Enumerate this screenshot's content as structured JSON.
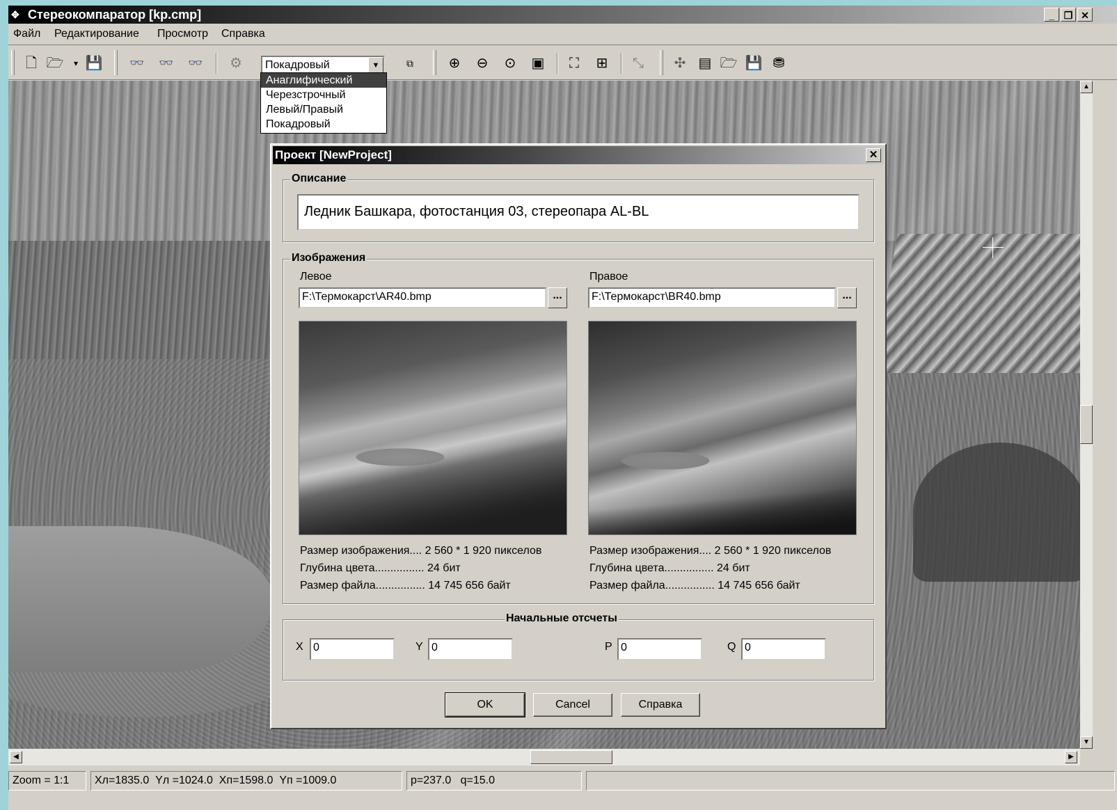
{
  "window": {
    "title": "Стереокомпаратор [kp.cmp]"
  },
  "menu": [
    "Файл",
    "Редактирование",
    "Просмотр",
    "Справка"
  ],
  "toolbar": {
    "mode_combo_value": "Покадровый",
    "mode_options": [
      "Анаглифический",
      "Черезстрочный",
      "Левый/Правый",
      "Покадровый"
    ],
    "selected_option_index": 0
  },
  "dialog": {
    "title": "Проект [NewProject]",
    "description_group": "Описание",
    "description": "Ледник Башкара, фотостанция 03, стереопара AL-BL",
    "images_group": "Изображения",
    "left": {
      "label": "Левое",
      "path": "F:\\Термокарст\\AR40.bmp",
      "info": [
        "Размер изображения.... 2 560 * 1 920 пикселов",
        "Глубина цвета................ 24 бит",
        "Размер файла................ 14 745 656 байт"
      ]
    },
    "right": {
      "label": "Правое",
      "path": "F:\\Термокарст\\BR40.bmp",
      "info": [
        "Размер изображения.... 2 560 * 1 920 пикселов",
        "Глубина цвета................ 24 бит",
        "Размер файла................ 14 745 656 байт"
      ]
    },
    "browse_label": "...",
    "origin_group": "Начальные отсчеты",
    "origin": {
      "x_label": "X",
      "x": "0",
      "y_label": "Y",
      "y": "0",
      "p_label": "P",
      "p": "0",
      "q_label": "Q",
      "q": "0"
    },
    "buttons": {
      "ok": "OK",
      "cancel": "Cancel",
      "help": "Справка"
    }
  },
  "status": {
    "zoom": "Zoom = 1:1",
    "coords": "Xл=1835.0  Yл =1024.0  Xп=1598.0  Yп =1009.0",
    "pq": "p=237.0   q=15.0"
  }
}
